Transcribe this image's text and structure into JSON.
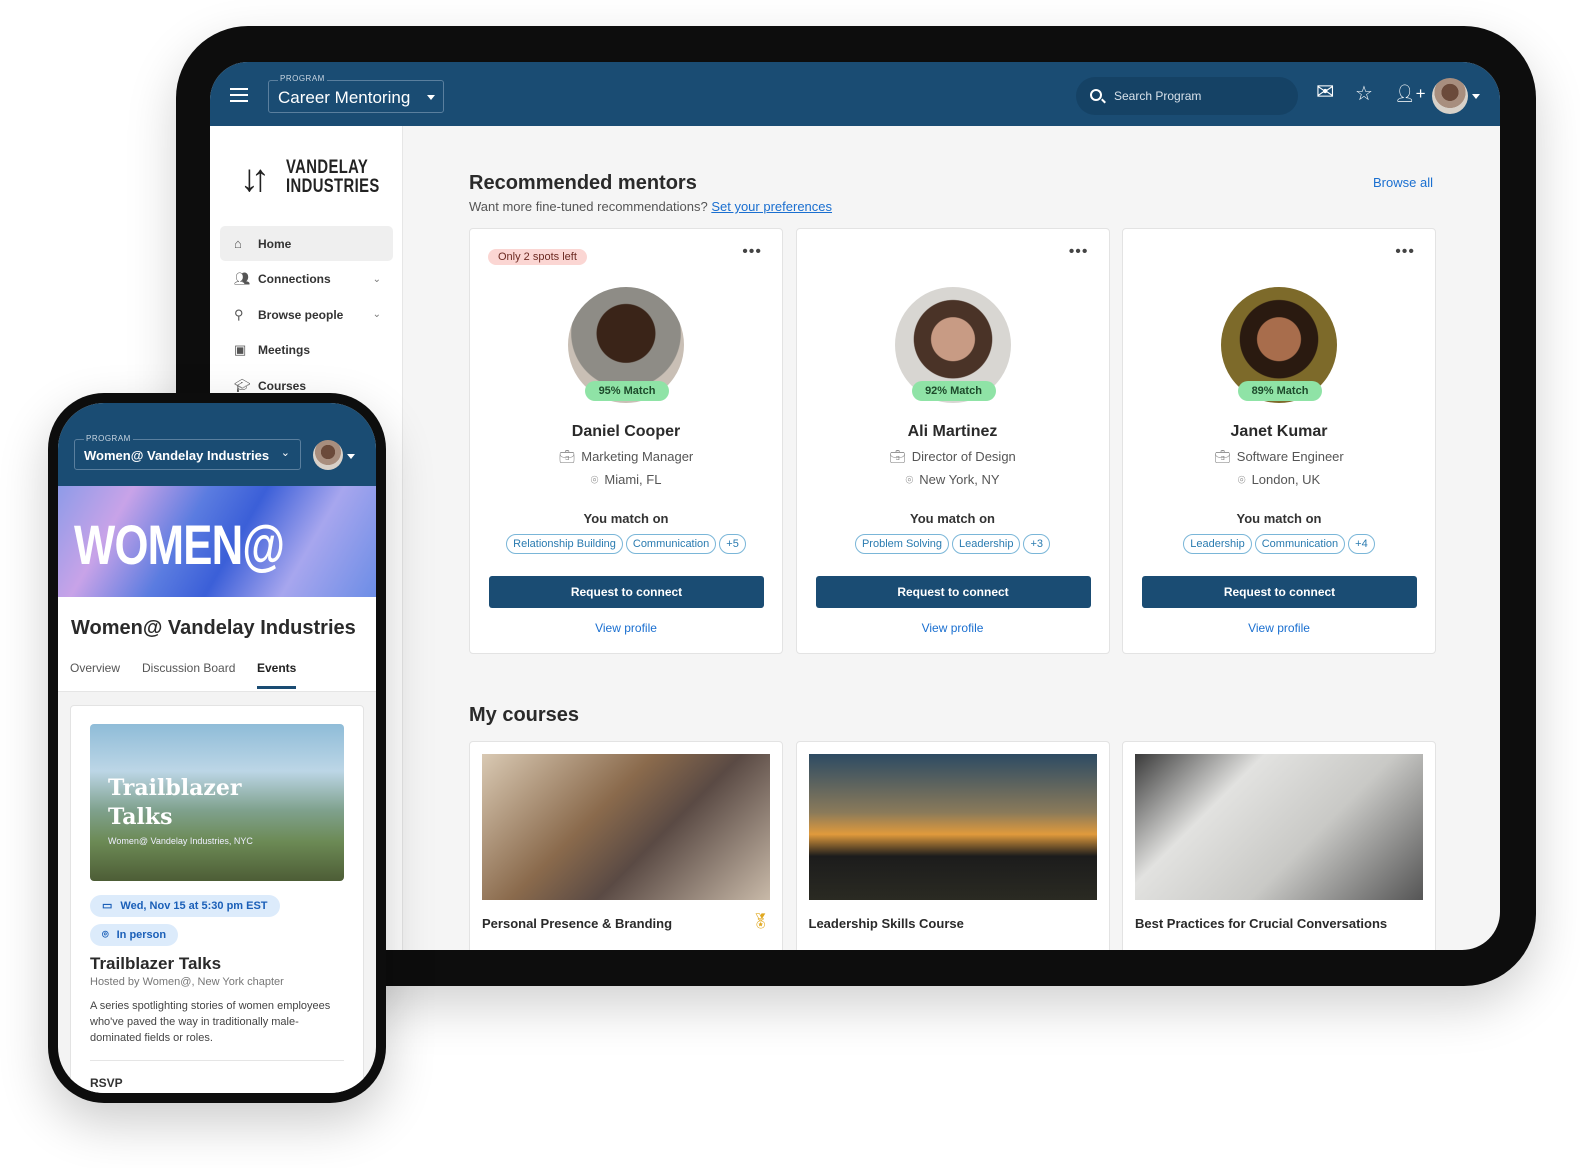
{
  "tablet": {
    "header": {
      "program_label": "PROGRAM",
      "program_value": "Career Mentoring",
      "search_placeholder": "Search Program",
      "icons": [
        "menu-icon",
        "mail-icon",
        "star-icon",
        "add-user-icon",
        "avatar"
      ]
    },
    "sidebar": {
      "logo": "VANDELAY INDUSTRIES",
      "logo_line1": "VANDELAY",
      "logo_line2": "INDUSTRIES",
      "items": [
        {
          "label": "Home",
          "icon": "home-icon",
          "active": true
        },
        {
          "label": "Connections",
          "icon": "connections-icon",
          "expandable": true
        },
        {
          "label": "Browse people",
          "icon": "browse-people-icon",
          "expandable": true
        },
        {
          "label": "Meetings",
          "icon": "calendar-icon"
        },
        {
          "label": "Courses",
          "icon": "graduation-cap-icon"
        }
      ]
    },
    "mentors": {
      "title": "Recommended mentors",
      "subtitle": "Want more fine-tuned recommendations?",
      "preferences_link": "Set your preferences",
      "browse_all": "Browse all",
      "match_on_label": "You match on",
      "request_label": "Request to connect",
      "view_profile_label": "View profile",
      "cards": [
        {
          "badge": "Only 2 spots left",
          "match": "95% Match",
          "name": "Daniel Cooper",
          "role": "Marketing Manager",
          "location": "Miami, FL",
          "chips": [
            "Relationship Building",
            "Communication",
            "+5"
          ]
        },
        {
          "badge": "",
          "match": "92% Match",
          "name": "Ali Martinez",
          "role": "Director of Design",
          "location": "New York, NY",
          "chips": [
            "Problem Solving",
            "Leadership",
            "+3"
          ]
        },
        {
          "badge": "",
          "match": "89% Match",
          "name": "Janet Kumar",
          "role": "Software Engineer",
          "location": "London, UK",
          "chips": [
            "Leadership",
            "Communication",
            "+4"
          ]
        }
      ]
    },
    "courses": {
      "title": "My courses",
      "items": [
        {
          "title": "Personal Presence & Branding",
          "award": true
        },
        {
          "title": "Leadership Skills Course"
        },
        {
          "title": "Best Practices for Crucial Conversations"
        }
      ]
    }
  },
  "phone": {
    "program_label": "PROGRAM",
    "program_value": "Women@ Vandelay Industries",
    "banner_text": "WOMEN@",
    "group_title": "Women@ Vandelay Industries",
    "tabs": [
      {
        "label": "Overview"
      },
      {
        "label": "Discussion Board"
      },
      {
        "label": "Events",
        "active": true
      }
    ],
    "event": {
      "image_title_line1": "Trailblazer",
      "image_title_line2": "Talks",
      "image_subtitle": "Women@ Vandelay Industries, NYC",
      "date": "Wed, Nov 15 at 5:30 pm EST",
      "mode": "In person",
      "title": "Trailblazer Talks",
      "host": "Hosted by Women@, New York chapter",
      "description": "A series spotlighting stories of women employees who've paved the way in traditionally male-dominated fields or roles.",
      "rsvp": "RSVP"
    }
  },
  "colors": {
    "header": "#1a4c73",
    "accent_link": "#1a6fd0",
    "match_badge": "#8fe3a6",
    "spots_badge": "#fbd6d3",
    "button": "#1a4c73"
  }
}
